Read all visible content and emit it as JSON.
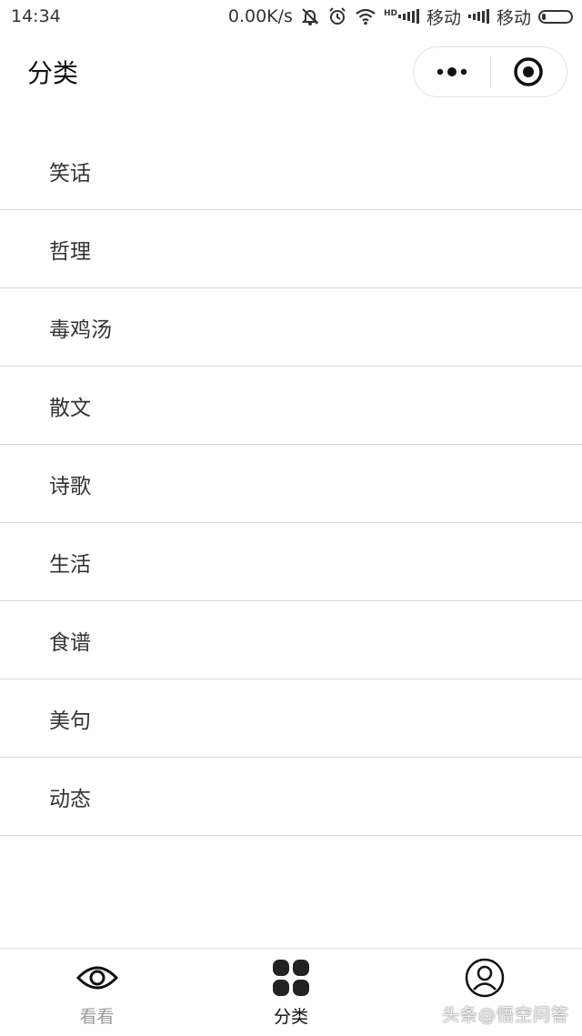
{
  "status_bar": {
    "time": "14:34",
    "network_speed": "0.00K/s",
    "carrier1": "移动",
    "carrier2": "移动",
    "hd": "HD",
    "icons": [
      "mute-bell-icon",
      "alarm-icon",
      "wifi-icon",
      "signal-icon",
      "battery-icon"
    ]
  },
  "nav": {
    "title": "分类",
    "capsule_icons": [
      "more-dots-icon",
      "target-close-icon"
    ]
  },
  "categories": [
    "笑话",
    "哲理",
    "毒鸡汤",
    "散文",
    "诗歌",
    "生活",
    "食谱",
    "美句",
    "动态"
  ],
  "tabbar": {
    "tabs": [
      {
        "label": "看看",
        "icon": "eye-icon",
        "active": false
      },
      {
        "label": "分类",
        "icon": "grid-icon",
        "active": true
      },
      {
        "label": "",
        "icon": "user-icon",
        "active": false
      }
    ]
  },
  "watermark": "头条@悟空问答",
  "colors": {
    "active": "#222222",
    "inactive": "#9a9a9a",
    "divider": "#d9d9d9"
  }
}
